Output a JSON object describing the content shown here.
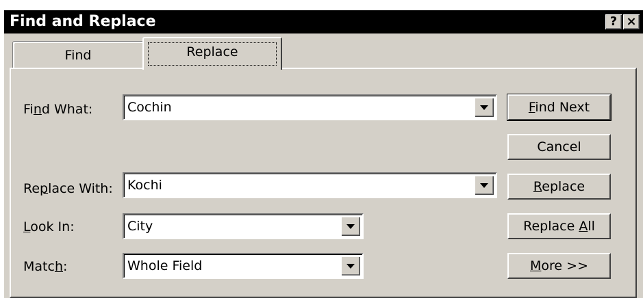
{
  "window": {
    "title": "Find and Replace",
    "help_glyph": "?",
    "close_glyph": "×"
  },
  "tabs": [
    {
      "label": "Find",
      "active": false
    },
    {
      "label": "Replace",
      "active": true
    }
  ],
  "fields": {
    "find_what": {
      "label_pre": "Fi",
      "label_acc": "n",
      "label_post": "d What:",
      "value": "Cochin"
    },
    "replace_with": {
      "label_pre": "Re",
      "label_acc": "p",
      "label_post": "lace With:",
      "value": "Kochi"
    },
    "look_in": {
      "label_pre": "",
      "label_acc": "L",
      "label_post": "ook In:",
      "value": "City"
    },
    "match": {
      "label_pre": "Matc",
      "label_acc": "h",
      "label_post": ":",
      "value": "Whole Field"
    }
  },
  "buttons": {
    "find_next": {
      "pre": "",
      "acc": "F",
      "post": "ind Next"
    },
    "cancel": {
      "pre": "Cancel",
      "acc": "",
      "post": ""
    },
    "replace": {
      "pre": "",
      "acc": "R",
      "post": "eplace"
    },
    "replace_all": {
      "pre": "Replace ",
      "acc": "A",
      "post": "ll"
    },
    "more": {
      "pre": "",
      "acc": "M",
      "post": "ore >>"
    }
  },
  "icons": {
    "dropdown": "triangle-down-icon",
    "help": "question-icon",
    "close": "close-icon"
  }
}
